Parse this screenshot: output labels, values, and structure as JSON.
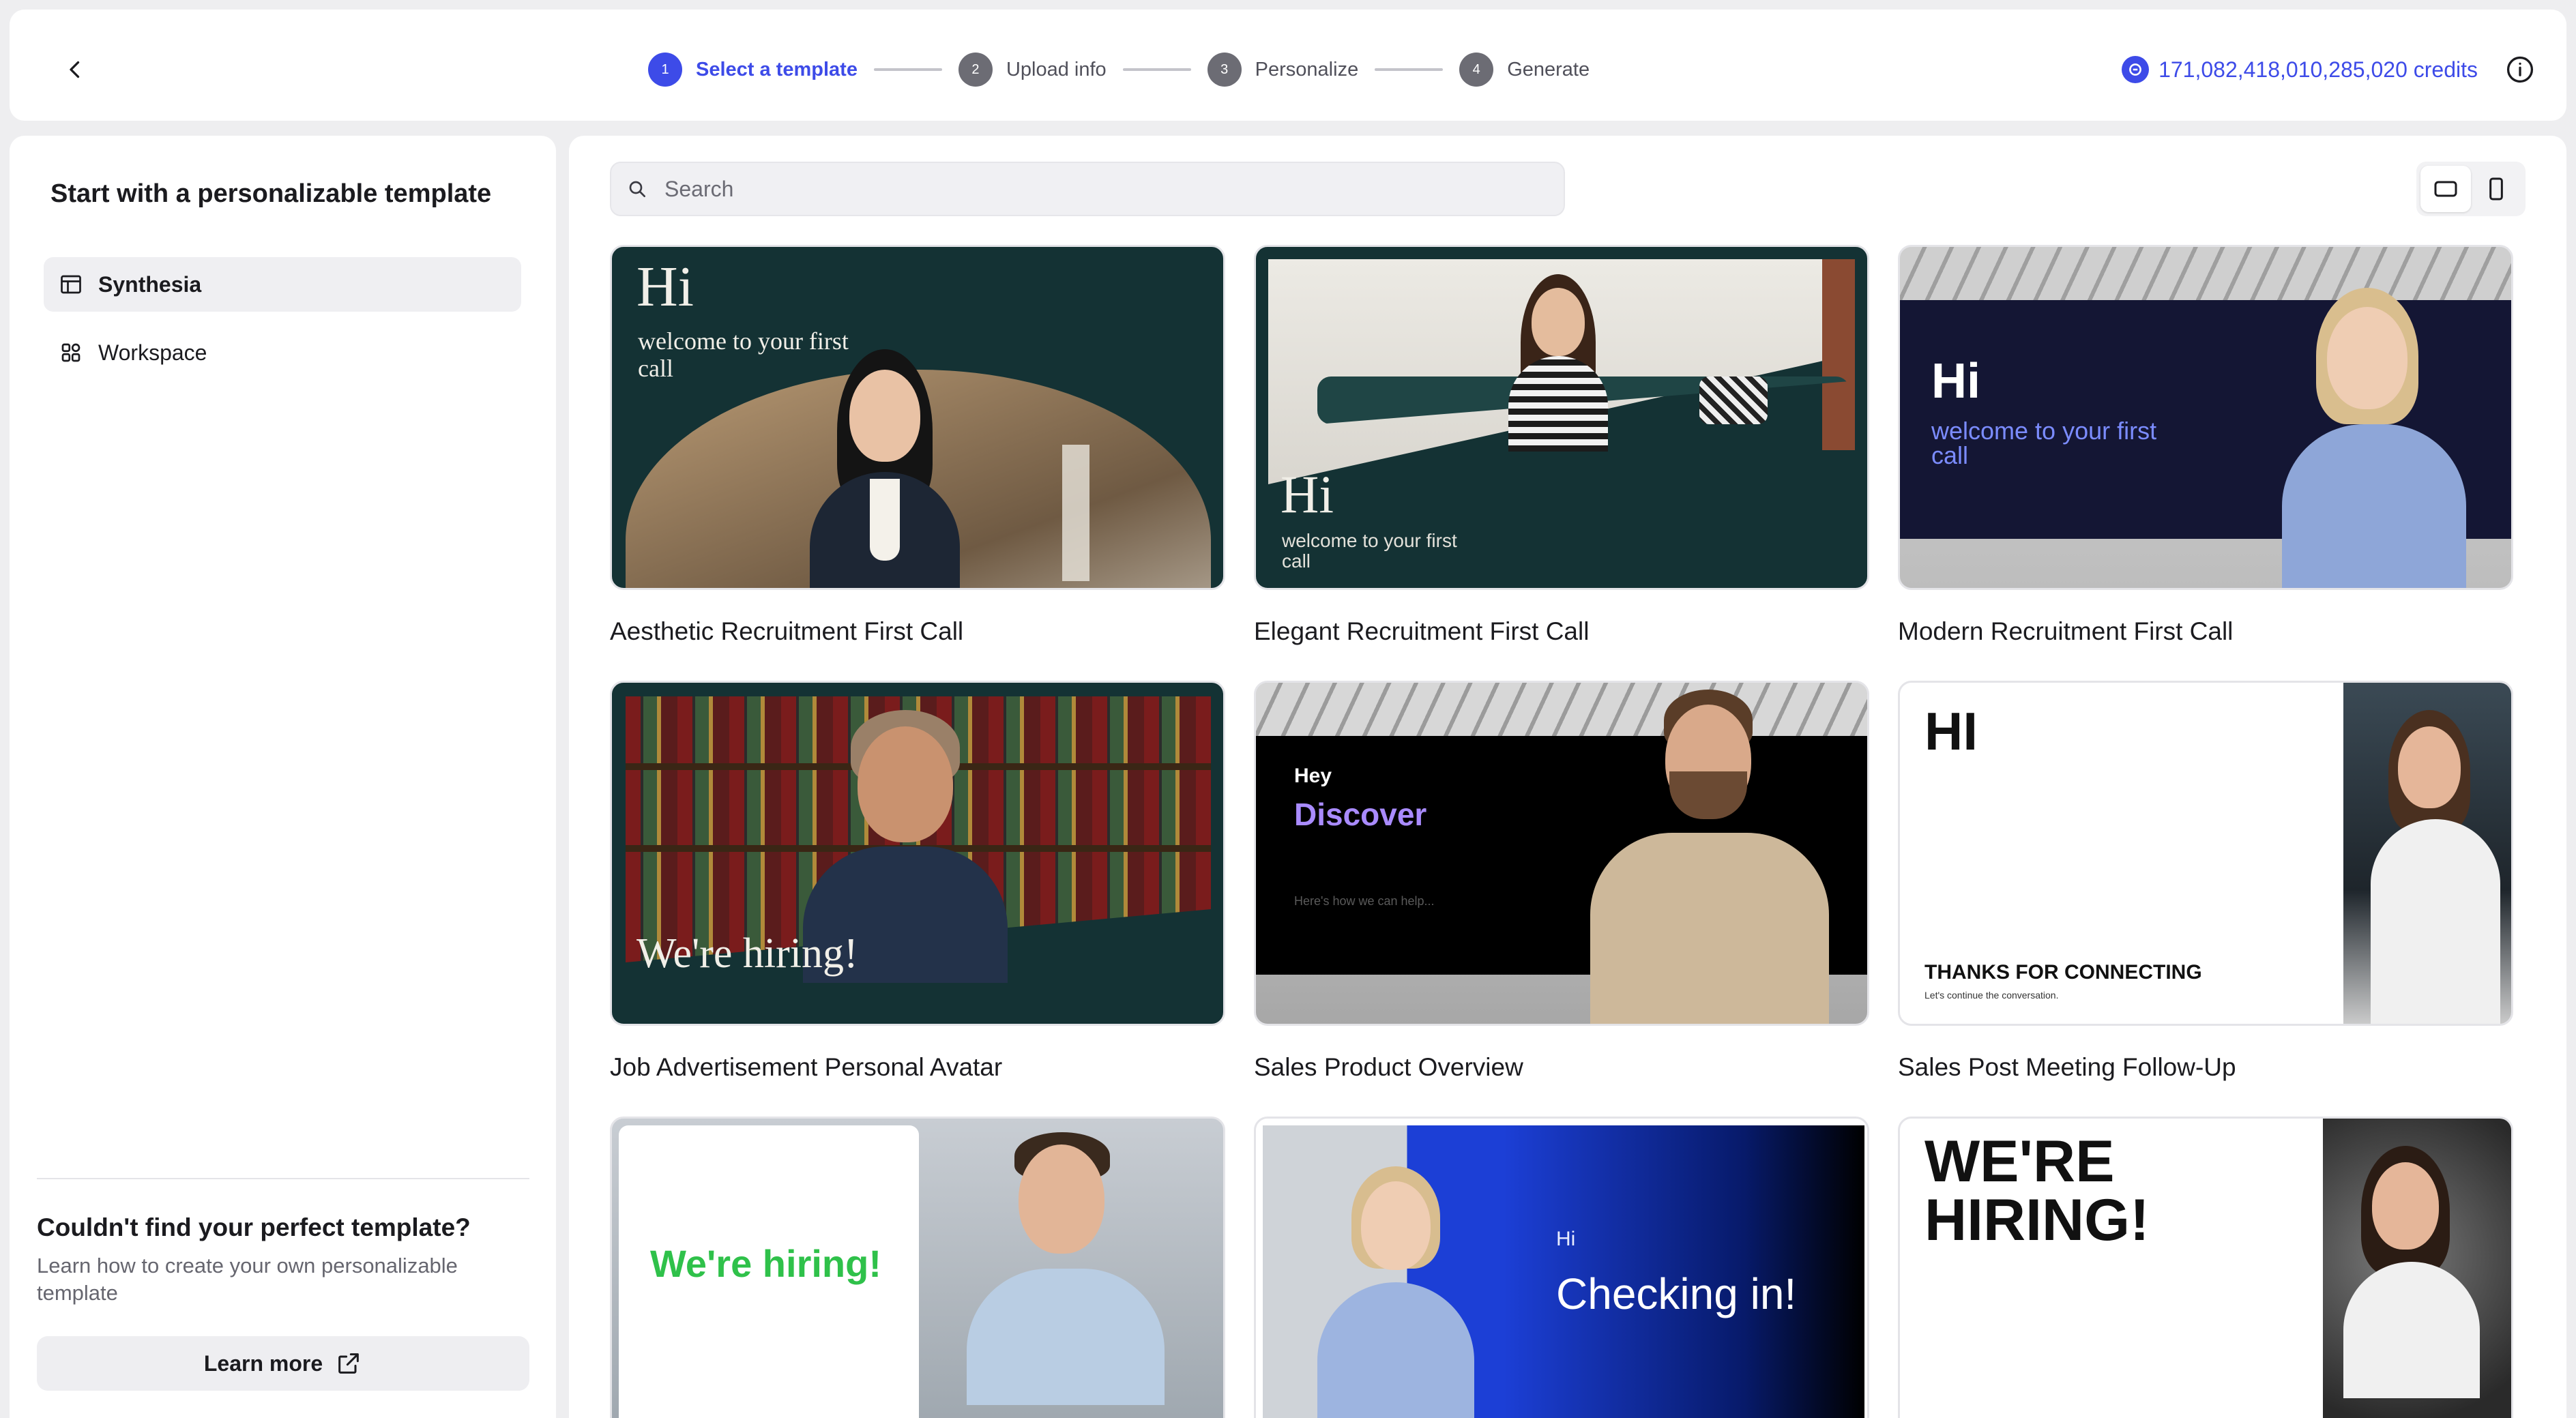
{
  "header": {
    "steps": [
      {
        "num": "1",
        "label": "Select a template"
      },
      {
        "num": "2",
        "label": "Upload info"
      },
      {
        "num": "3",
        "label": "Personalize"
      },
      {
        "num": "4",
        "label": "Generate"
      }
    ],
    "credits": "171,082,418,010,285,020 credits"
  },
  "sidebar": {
    "title": "Start with a personalizable template",
    "items": [
      {
        "label": "Synthesia"
      },
      {
        "label": "Workspace"
      }
    ],
    "help_title": "Couldn't find your perfect template?",
    "help_text": "Learn how to create your own personalizable template",
    "learn_more": "Learn more"
  },
  "main": {
    "search_placeholder": "Search",
    "templates": [
      {
        "title": "Aesthetic Recruitment First Call",
        "hi": "Hi",
        "sub": "welcome to your first call"
      },
      {
        "title": "Elegant Recruitment First Call",
        "hi": "Hi",
        "sub": "welcome to your first call"
      },
      {
        "title": "Modern Recruitment First Call",
        "hi": "Hi",
        "sub": "welcome to your first call"
      },
      {
        "title": "Job Advertisement Personal Avatar",
        "headline": "We're hiring!"
      },
      {
        "title": "Sales Product Overview",
        "hey": "Hey",
        "headline": "Discover",
        "small": "Here's how we can help..."
      },
      {
        "title": "Sales Post Meeting Follow-Up",
        "hi": "HI",
        "headline": "THANKS FOR CONNECTING",
        "small": "Let's continue the conversation."
      },
      {
        "title": "",
        "headline": "We're hiring!"
      },
      {
        "title": "",
        "hi": "Hi",
        "headline": "Checking in!"
      },
      {
        "title": "",
        "headline": "WE'RE HIRING!"
      }
    ]
  },
  "colors": {
    "accent": "#3d4be8",
    "dark_teal": "#143234",
    "navy": "#141634",
    "green": "#2fc14a"
  }
}
